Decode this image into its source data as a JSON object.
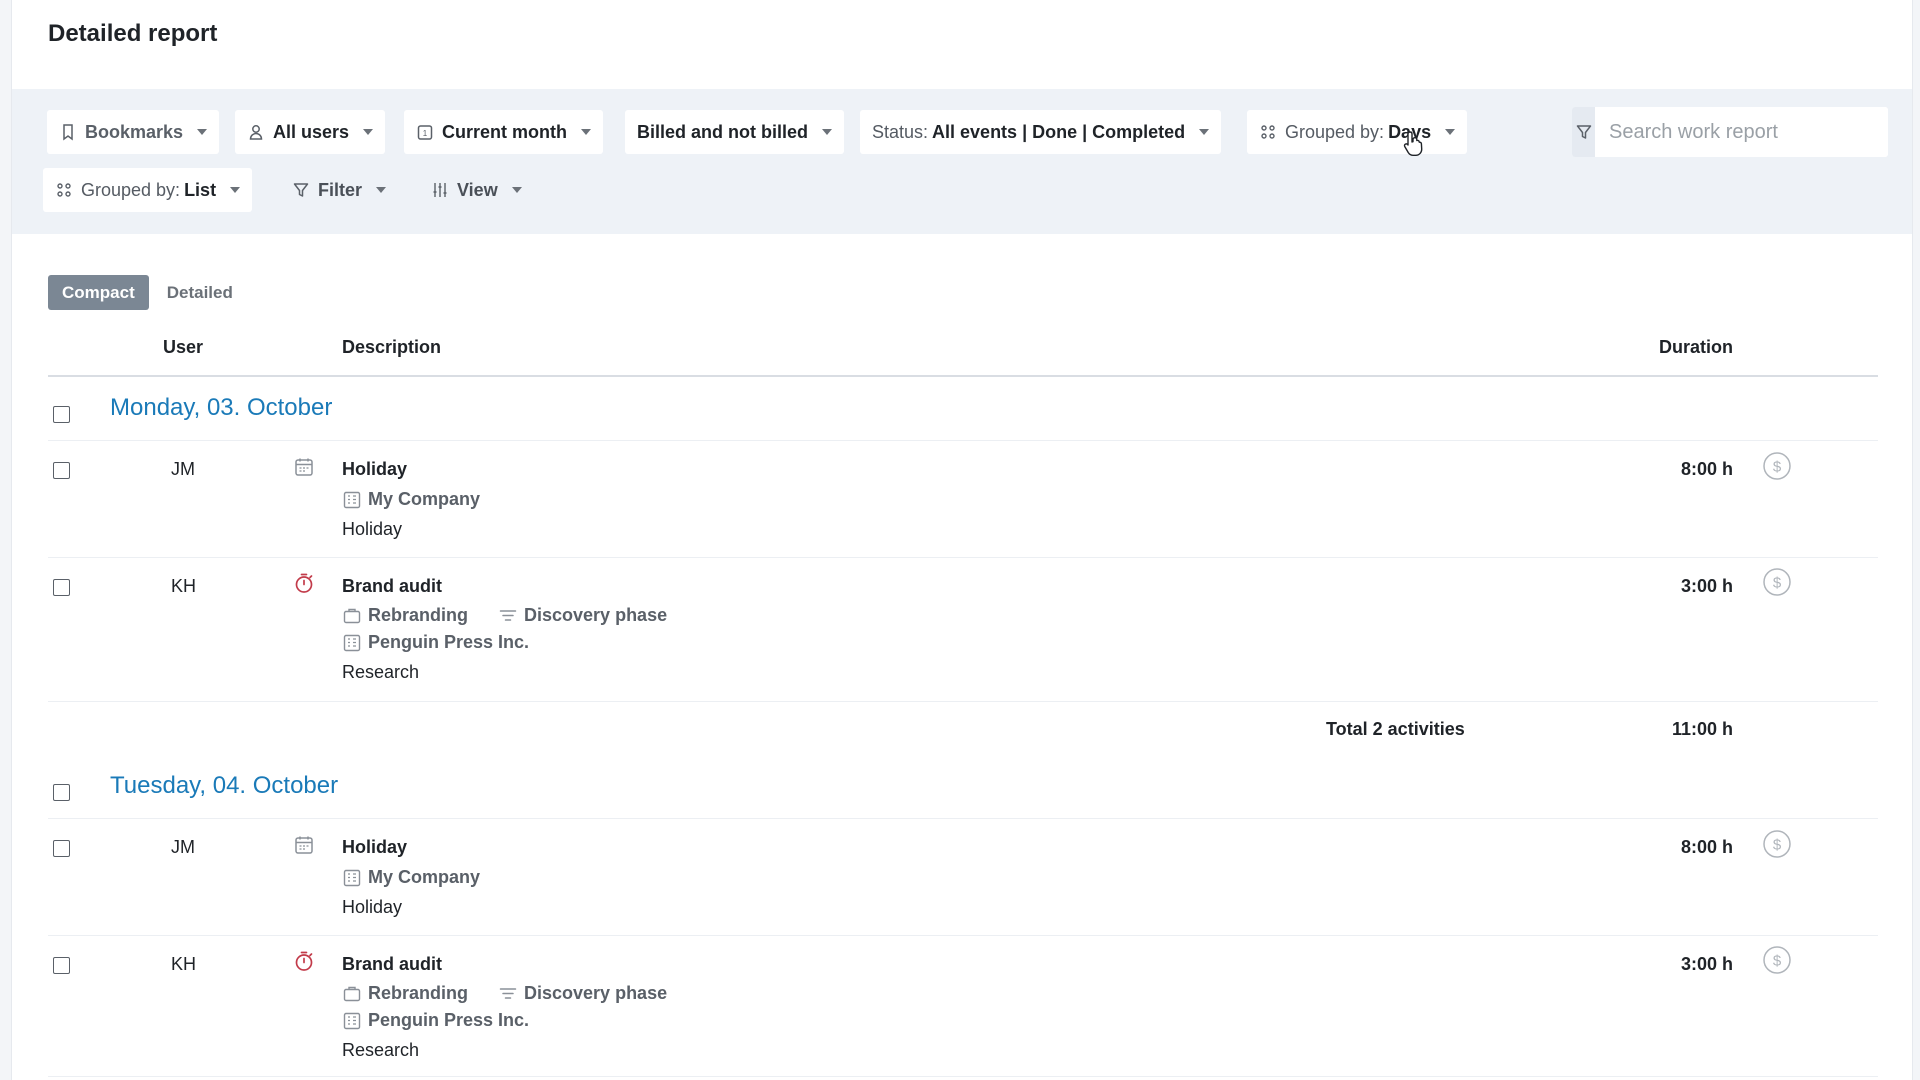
{
  "page": {
    "title": "Detailed report"
  },
  "toolbar": {
    "bookmarks": "Bookmarks",
    "users": "All users",
    "period": "Current month",
    "billing": "Billed and not billed",
    "status_prefix": "Status:",
    "status_value": "All events | Done | Completed",
    "group1_prefix": "Grouped by:",
    "group1_value": "Days",
    "group2_prefix": "Grouped by:",
    "group2_value": "List",
    "filter": "Filter",
    "view": "View",
    "search_placeholder": "Search work report"
  },
  "tabs": {
    "compact": "Compact",
    "detailed": "Detailed",
    "active": "compact"
  },
  "columns": {
    "user": "User",
    "description": "Description",
    "duration": "Duration"
  },
  "days": [
    {
      "heading": "Monday, 03. October",
      "entries": [
        {
          "user": "JM",
          "icon": "calendar-icon",
          "title": "Holiday",
          "project": "",
          "phase": "",
          "client": "My Company",
          "note": "Holiday",
          "duration": "8:00 h",
          "billing_icon": "dollar-icon"
        },
        {
          "user": "KH",
          "icon": "stopwatch-icon",
          "title": "Brand audit",
          "project": "Rebranding",
          "phase": "Discovery phase",
          "client": "Penguin Press Inc.",
          "note": "Research",
          "duration": "3:00 h",
          "billing_icon": "dollar-icon"
        }
      ],
      "total_label": "Total 2 activities",
      "total_duration": "11:00 h"
    },
    {
      "heading": "Tuesday, 04. October",
      "entries": [
        {
          "user": "JM",
          "icon": "calendar-icon",
          "title": "Holiday",
          "project": "",
          "phase": "",
          "client": "My Company",
          "note": "Holiday",
          "duration": "8:00 h",
          "billing_icon": "dollar-icon"
        },
        {
          "user": "KH",
          "icon": "stopwatch-icon",
          "title": "Brand audit",
          "project": "Rebranding",
          "phase": "Discovery phase",
          "client": "Penguin Press Inc.",
          "note": "Research",
          "duration": "3:00 h",
          "billing_icon": "dollar-icon"
        }
      ]
    }
  ],
  "colors": {
    "accent": "#1a7ab8",
    "toolbar_bg": "#eef2f7",
    "tab_active": "#7b8794",
    "stopwatch": "#c23b4a"
  }
}
